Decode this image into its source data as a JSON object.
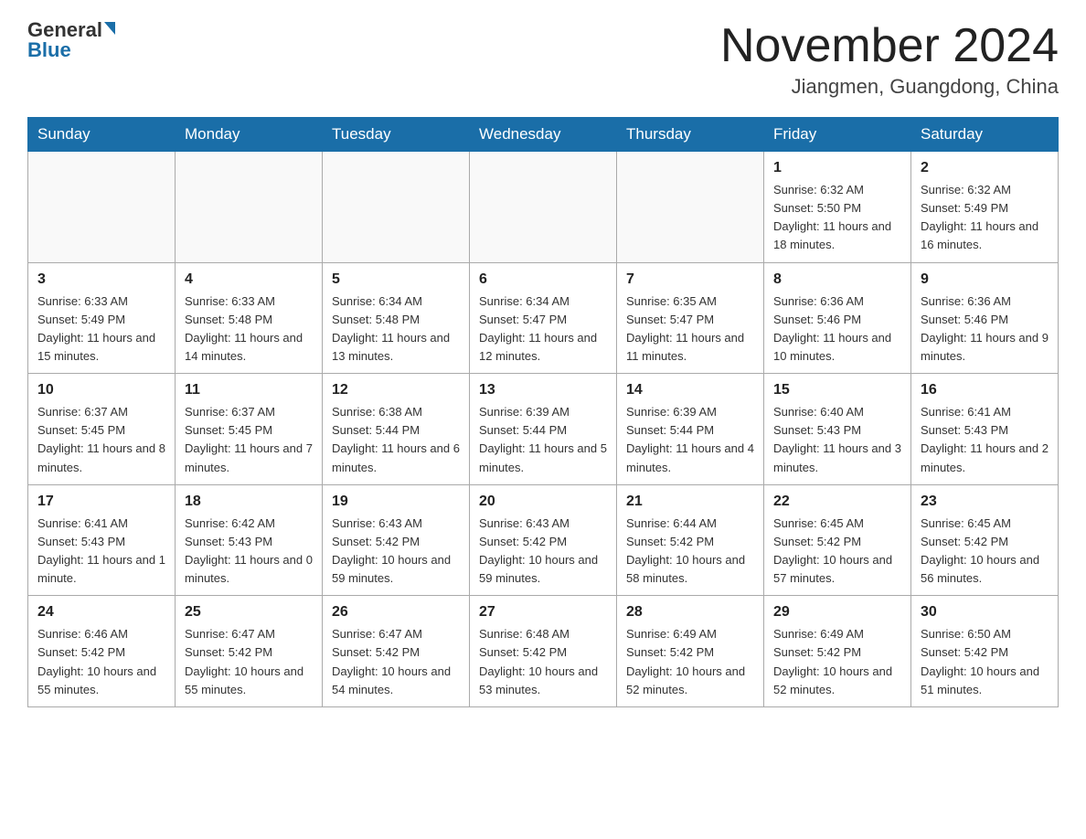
{
  "header": {
    "logo_general": "General",
    "logo_blue": "Blue",
    "month_title": "November 2024",
    "location": "Jiangmen, Guangdong, China"
  },
  "days_of_week": [
    "Sunday",
    "Monday",
    "Tuesday",
    "Wednesday",
    "Thursday",
    "Friday",
    "Saturday"
  ],
  "weeks": [
    [
      {
        "day": "",
        "info": ""
      },
      {
        "day": "",
        "info": ""
      },
      {
        "day": "",
        "info": ""
      },
      {
        "day": "",
        "info": ""
      },
      {
        "day": "",
        "info": ""
      },
      {
        "day": "1",
        "info": "Sunrise: 6:32 AM\nSunset: 5:50 PM\nDaylight: 11 hours and 18 minutes."
      },
      {
        "day": "2",
        "info": "Sunrise: 6:32 AM\nSunset: 5:49 PM\nDaylight: 11 hours and 16 minutes."
      }
    ],
    [
      {
        "day": "3",
        "info": "Sunrise: 6:33 AM\nSunset: 5:49 PM\nDaylight: 11 hours and 15 minutes."
      },
      {
        "day": "4",
        "info": "Sunrise: 6:33 AM\nSunset: 5:48 PM\nDaylight: 11 hours and 14 minutes."
      },
      {
        "day": "5",
        "info": "Sunrise: 6:34 AM\nSunset: 5:48 PM\nDaylight: 11 hours and 13 minutes."
      },
      {
        "day": "6",
        "info": "Sunrise: 6:34 AM\nSunset: 5:47 PM\nDaylight: 11 hours and 12 minutes."
      },
      {
        "day": "7",
        "info": "Sunrise: 6:35 AM\nSunset: 5:47 PM\nDaylight: 11 hours and 11 minutes."
      },
      {
        "day": "8",
        "info": "Sunrise: 6:36 AM\nSunset: 5:46 PM\nDaylight: 11 hours and 10 minutes."
      },
      {
        "day": "9",
        "info": "Sunrise: 6:36 AM\nSunset: 5:46 PM\nDaylight: 11 hours and 9 minutes."
      }
    ],
    [
      {
        "day": "10",
        "info": "Sunrise: 6:37 AM\nSunset: 5:45 PM\nDaylight: 11 hours and 8 minutes."
      },
      {
        "day": "11",
        "info": "Sunrise: 6:37 AM\nSunset: 5:45 PM\nDaylight: 11 hours and 7 minutes."
      },
      {
        "day": "12",
        "info": "Sunrise: 6:38 AM\nSunset: 5:44 PM\nDaylight: 11 hours and 6 minutes."
      },
      {
        "day": "13",
        "info": "Sunrise: 6:39 AM\nSunset: 5:44 PM\nDaylight: 11 hours and 5 minutes."
      },
      {
        "day": "14",
        "info": "Sunrise: 6:39 AM\nSunset: 5:44 PM\nDaylight: 11 hours and 4 minutes."
      },
      {
        "day": "15",
        "info": "Sunrise: 6:40 AM\nSunset: 5:43 PM\nDaylight: 11 hours and 3 minutes."
      },
      {
        "day": "16",
        "info": "Sunrise: 6:41 AM\nSunset: 5:43 PM\nDaylight: 11 hours and 2 minutes."
      }
    ],
    [
      {
        "day": "17",
        "info": "Sunrise: 6:41 AM\nSunset: 5:43 PM\nDaylight: 11 hours and 1 minute."
      },
      {
        "day": "18",
        "info": "Sunrise: 6:42 AM\nSunset: 5:43 PM\nDaylight: 11 hours and 0 minutes."
      },
      {
        "day": "19",
        "info": "Sunrise: 6:43 AM\nSunset: 5:42 PM\nDaylight: 10 hours and 59 minutes."
      },
      {
        "day": "20",
        "info": "Sunrise: 6:43 AM\nSunset: 5:42 PM\nDaylight: 10 hours and 59 minutes."
      },
      {
        "day": "21",
        "info": "Sunrise: 6:44 AM\nSunset: 5:42 PM\nDaylight: 10 hours and 58 minutes."
      },
      {
        "day": "22",
        "info": "Sunrise: 6:45 AM\nSunset: 5:42 PM\nDaylight: 10 hours and 57 minutes."
      },
      {
        "day": "23",
        "info": "Sunrise: 6:45 AM\nSunset: 5:42 PM\nDaylight: 10 hours and 56 minutes."
      }
    ],
    [
      {
        "day": "24",
        "info": "Sunrise: 6:46 AM\nSunset: 5:42 PM\nDaylight: 10 hours and 55 minutes."
      },
      {
        "day": "25",
        "info": "Sunrise: 6:47 AM\nSunset: 5:42 PM\nDaylight: 10 hours and 55 minutes."
      },
      {
        "day": "26",
        "info": "Sunrise: 6:47 AM\nSunset: 5:42 PM\nDaylight: 10 hours and 54 minutes."
      },
      {
        "day": "27",
        "info": "Sunrise: 6:48 AM\nSunset: 5:42 PM\nDaylight: 10 hours and 53 minutes."
      },
      {
        "day": "28",
        "info": "Sunrise: 6:49 AM\nSunset: 5:42 PM\nDaylight: 10 hours and 52 minutes."
      },
      {
        "day": "29",
        "info": "Sunrise: 6:49 AM\nSunset: 5:42 PM\nDaylight: 10 hours and 52 minutes."
      },
      {
        "day": "30",
        "info": "Sunrise: 6:50 AM\nSunset: 5:42 PM\nDaylight: 10 hours and 51 minutes."
      }
    ]
  ]
}
